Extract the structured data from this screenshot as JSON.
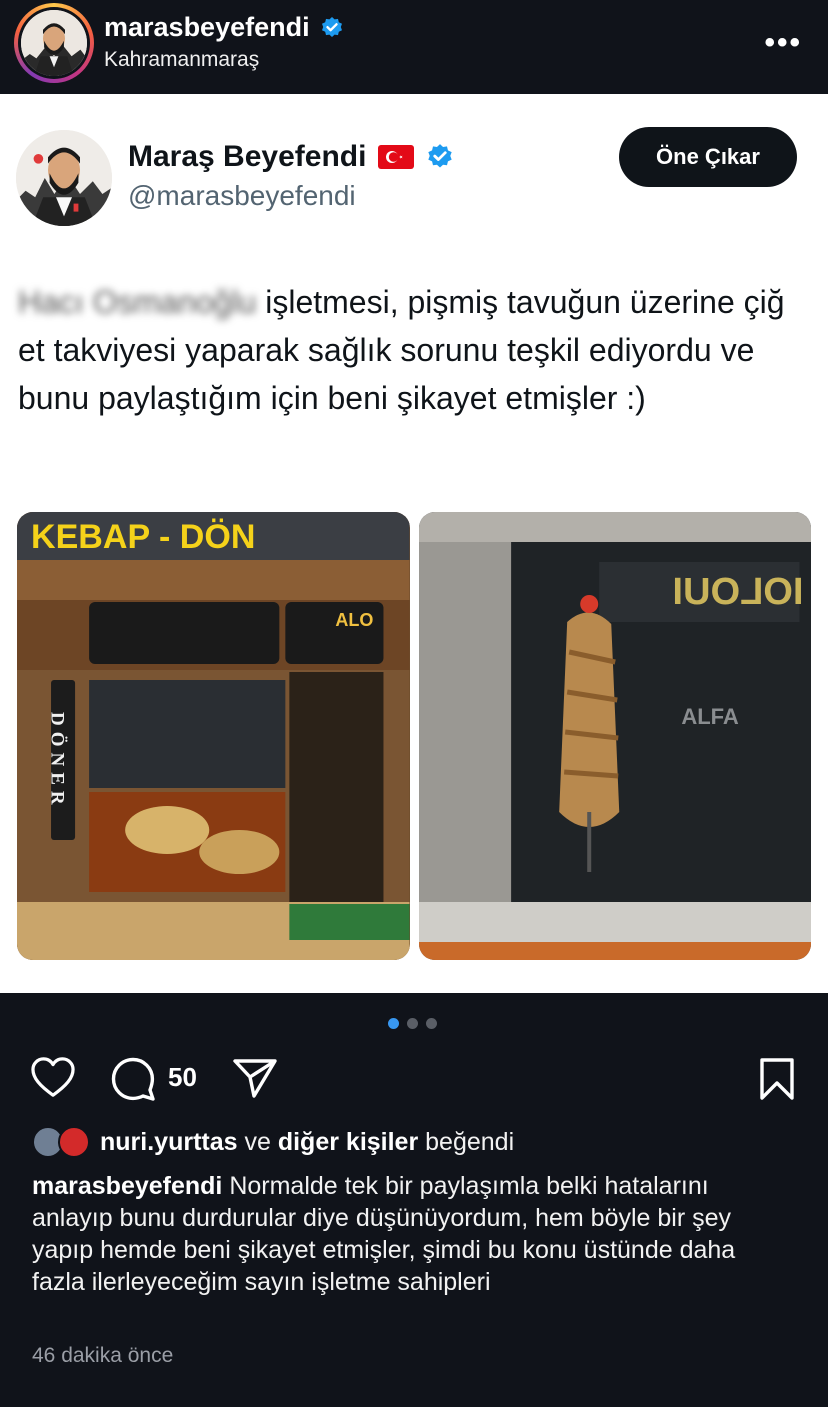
{
  "header": {
    "username": "marasbeyefendi",
    "location": "Kahramanmaraş",
    "more_label": "•••"
  },
  "tweet": {
    "display_name": "Maraş Beyefendi",
    "handle": "@marasbeyefendi",
    "follow_button": "Öne Çıkar",
    "blurred_prefix": "Hacı Osmanoğlu",
    "text": " işletmesi, pişmiş tavuğun üzerine çiğ et takviyesi yaparak sağlık sorunu teşkil ediyordu ve bunu paylaştığım için beni şikayet etmişler :)",
    "images": [
      {
        "sign_text": "KEBAP - DÖN",
        "vertical_sign": "DÖNER",
        "shop_label": "ALO"
      },
      {
        "shop_label": "ALFA"
      }
    ]
  },
  "carousel": {
    "count": 3,
    "active": 0
  },
  "actions": {
    "comment_count": "50"
  },
  "likes": {
    "user": "nuri.yurttas",
    "connector": "ve",
    "others": "diğer kişiler",
    "suffix": "beğendi"
  },
  "caption": {
    "username": "marasbeyefendi",
    "text": "Normalde tek bir paylaşımla belki hatalarını anlayıp bunu durdurular diye düşünüyordum, hem böyle bir şey yapıp hemde beni şikayet etmişler, şimdi bu konu üstünde daha fazla ilerleyeceğim sayın işletme sahipleri"
  },
  "timestamp": "46 dakika önce",
  "colors": {
    "verified": "#1d9bf0",
    "background": "#10131a",
    "active_dot": "#3897f0"
  }
}
